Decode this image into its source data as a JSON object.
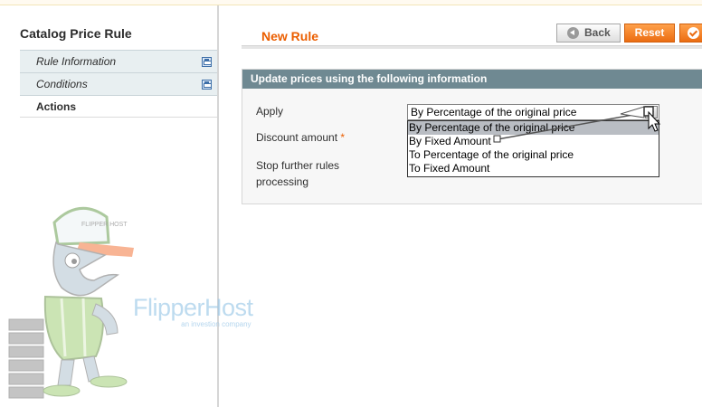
{
  "sidebar": {
    "title": "Catalog Price Rule",
    "tabs": [
      {
        "label": "Rule Information",
        "icon": "save-icon"
      },
      {
        "label": "Conditions",
        "icon": "save-icon"
      },
      {
        "label": "Actions"
      }
    ]
  },
  "header": {
    "title": "New Rule",
    "buttons": {
      "back": "Back",
      "reset": "Reset",
      "save_icon": "check-icon"
    }
  },
  "fieldset": {
    "title": "Update prices using the following information",
    "fields": {
      "apply_label": "Apply",
      "discount_label": "Discount amount",
      "required_mark": "*",
      "stop_label_line1": "Stop further rules",
      "stop_label_line2": "processing"
    },
    "apply_select": {
      "value": "By Percentage of the original price",
      "options": [
        "By Percentage of the original price",
        "By Fixed Amount",
        "To Percentage of the original price",
        "To Fixed Amount"
      ],
      "highlighted_index": 0
    }
  },
  "watermark": {
    "brand": "FlipperHost",
    "tagline": "an investion company",
    "cap_text": "FLIPPER HOST"
  },
  "colors": {
    "accent_orange": "#eb5e00",
    "fieldset_header": "#6f8992",
    "tab_background": "#e8eff1"
  }
}
